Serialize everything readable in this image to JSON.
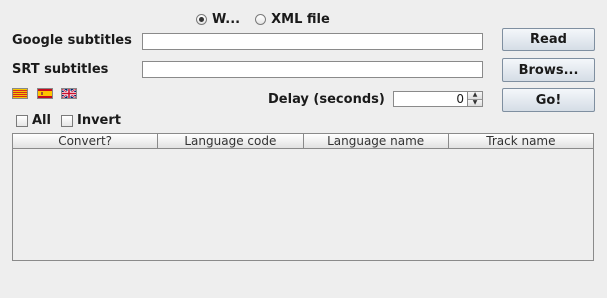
{
  "source_mode": {
    "options": [
      {
        "label": "W...",
        "selected": true
      },
      {
        "label": "XML file",
        "selected": false
      }
    ]
  },
  "google_subtitles": {
    "label": "Google subtitles",
    "value": ""
  },
  "srt_subtitles": {
    "label": "SRT subtitles",
    "value": ""
  },
  "buttons": {
    "read": "Read",
    "browse": "Brows...",
    "go": "Go!"
  },
  "language_flags": [
    "catalan-flag-icon",
    "spanish-flag-icon",
    "uk-flag-icon"
  ],
  "delay": {
    "label": "Delay (seconds)",
    "value": "0"
  },
  "filters": {
    "all": {
      "label": "All",
      "checked": false
    },
    "invert": {
      "label": "Invert",
      "checked": false
    }
  },
  "table": {
    "columns": [
      "Convert?",
      "Language code",
      "Language name",
      "Track name"
    ],
    "rows": []
  },
  "colors": {
    "background": "#eeeeee",
    "button_top": "#f4f7fa",
    "button_bottom": "#d5dde6"
  }
}
